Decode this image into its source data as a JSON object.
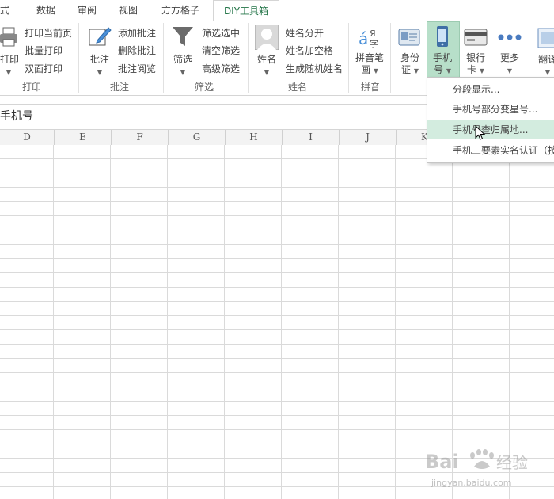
{
  "tabs": [
    {
      "label": "公式"
    },
    {
      "label": "数据"
    },
    {
      "label": "审阅"
    },
    {
      "label": "视图"
    },
    {
      "label": "方方格子"
    },
    {
      "label": "DIY工具箱"
    }
  ],
  "ribbon": {
    "print_group": {
      "big_label": "打印",
      "items": [
        "打印当前页",
        "批量打印",
        "双面打印"
      ],
      "group_label": "打印"
    },
    "comment_group": {
      "big_label": "批注",
      "items": [
        "添加批注",
        "删除批注",
        "批注阅览"
      ],
      "group_label": "批注"
    },
    "filter_group": {
      "big_label": "筛选",
      "items": [
        "筛选选中",
        "清空筛选",
        "高级筛选"
      ],
      "group_label": "筛选"
    },
    "name_group": {
      "big_label": "姓名",
      "items": [
        "姓名分开",
        "姓名加空格",
        "生成随机姓名"
      ],
      "group_label": "姓名"
    },
    "pinyin_group": {
      "big_label_line1": "拼音笔",
      "big_label_line2": "画",
      "group_label": "拼音"
    },
    "id_button": {
      "line1": "身份",
      "line2": "证"
    },
    "phone_button": {
      "line1": "手机",
      "line2": "号"
    },
    "bank_button": {
      "line1": "银行",
      "line2": "卡"
    },
    "more_button": {
      "line1": "更多"
    },
    "translate_button": {
      "line1": "翻译"
    }
  },
  "formula_bar": {
    "value": "手机号"
  },
  "columns": [
    "D",
    "E",
    "F",
    "G",
    "H",
    "I",
    "J",
    "K"
  ],
  "dropdown": {
    "items": [
      "分段显示...",
      "手机号部分变星号...",
      "手机号查归属地...",
      "手机三要素实名认证（按"
    ]
  },
  "watermark": {
    "brand": "Bai",
    "brand2": "经验",
    "url": "jingyan.baidu.com"
  },
  "colors": {
    "accent": "#217346",
    "highlight": "#b7dfc9",
    "menu_hover": "#d3ecdf"
  }
}
